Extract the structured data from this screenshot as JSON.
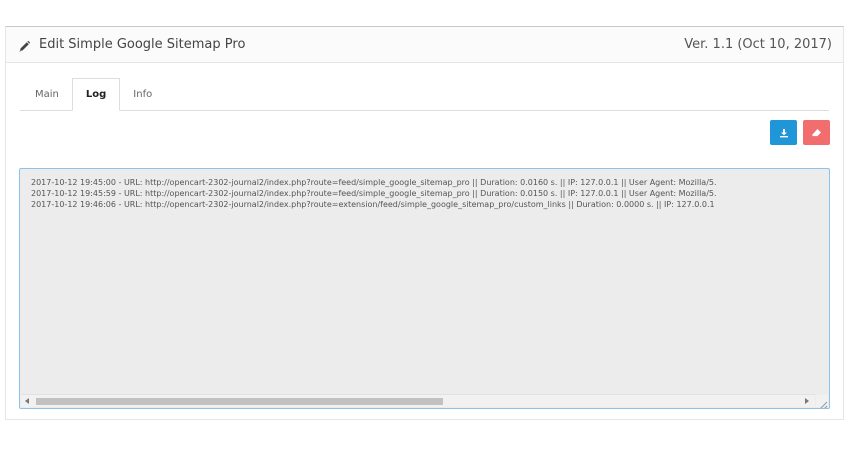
{
  "header": {
    "title": "Edit Simple Google Sitemap Pro",
    "version": "Ver. 1.1 (Oct 10, 2017)",
    "icon": "pencil-icon"
  },
  "tabs": [
    {
      "label": "Main",
      "active": false
    },
    {
      "label": "Log",
      "active": true
    },
    {
      "label": "Info",
      "active": false
    }
  ],
  "actions": {
    "download_icon": "download-icon",
    "erase_icon": "eraser-icon",
    "download_color": "#1f96d8",
    "erase_color": "#f26d6d"
  },
  "log": {
    "lines": [
      "2017-10-12 19:45:00 - URL: http://opencart-2302-journal2/index.php?route=feed/simple_google_sitemap_pro || Duration: 0.0160 s. || IP: 127.0.0.1 || User Agent: Mozilla/5.",
      "2017-10-12 19:45:59 - URL: http://opencart-2302-journal2/index.php?route=feed/simple_google_sitemap_pro || Duration: 0.0150 s. || IP: 127.0.0.1 || User Agent: Mozilla/5.",
      "2017-10-12 19:46:06 - URL: http://opencart-2302-journal2/index.php?route=extension/feed/simple_google_sitemap_pro/custom_links || Duration: 0.0000 s. || IP: 127.0.0.1"
    ]
  }
}
